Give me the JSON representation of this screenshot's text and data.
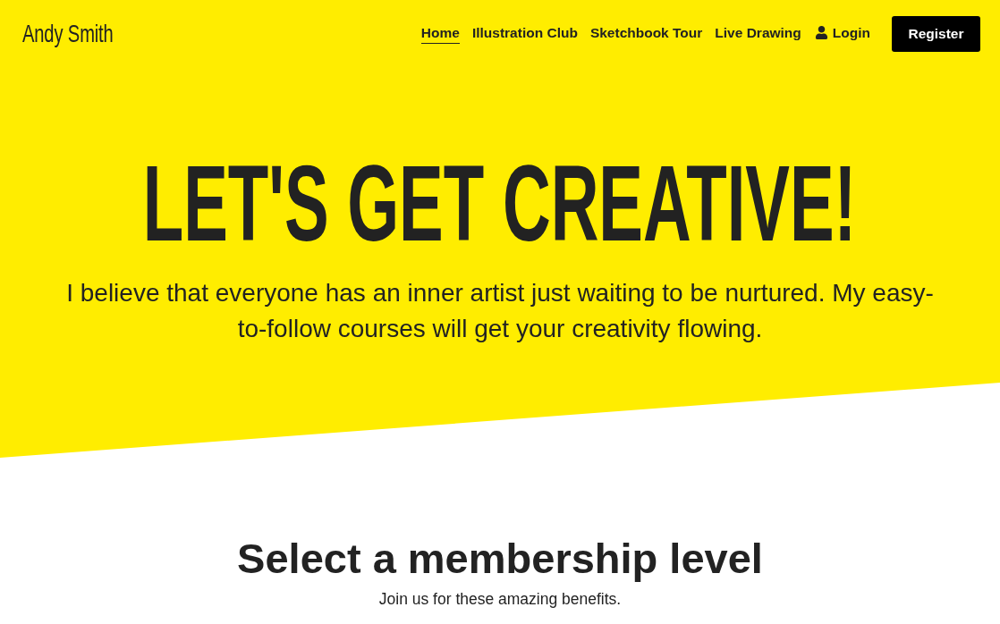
{
  "header": {
    "logo": "Andy Smith",
    "nav_links": [
      {
        "label": "Home",
        "selected": true
      },
      {
        "label": "Illustration Club",
        "selected": false
      },
      {
        "label": "Sketchbook Tour",
        "selected": false
      },
      {
        "label": "Live Drawing",
        "selected": false
      }
    ],
    "login": {
      "label": "Login"
    },
    "register": {
      "label": "Register"
    }
  },
  "hero": {
    "title": "LET'S GET CREATIVE!",
    "text": "I believe that everyone has an inner artist just waiting to be nurtured. My easy-to-follow courses will get your creativity flowing."
  },
  "membership": {
    "title": "Select a membership level",
    "subtitle": "Join us for these amazing benefits."
  }
}
